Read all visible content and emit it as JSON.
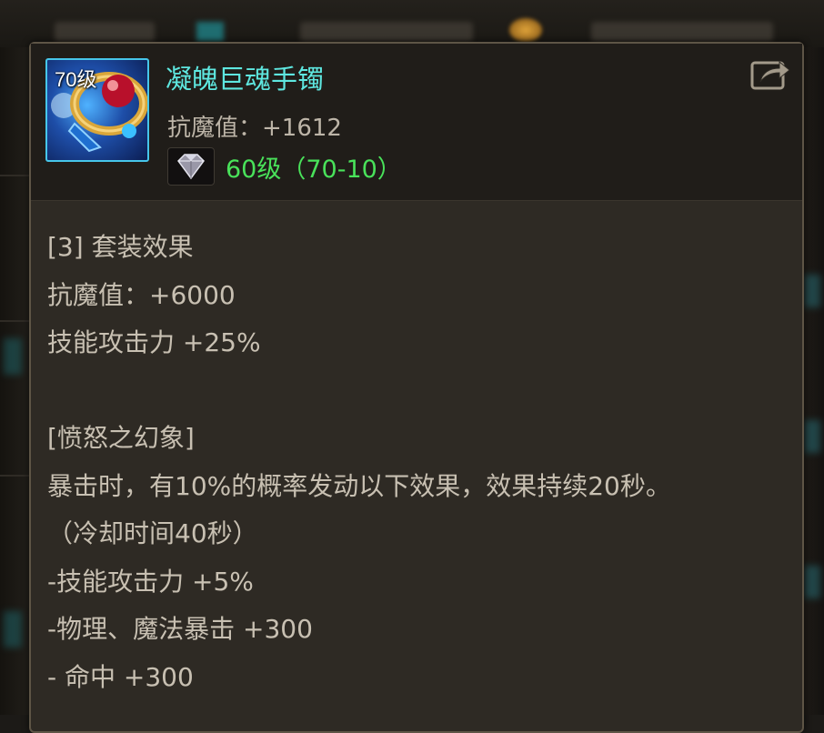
{
  "item": {
    "name": "凝魄巨魂手镯",
    "level_label": "70级",
    "stat": "抗魔值：+1612",
    "gem_level": "60级（70-10）"
  },
  "set_effect": {
    "header": "[3] 套装效果",
    "lines": [
      "抗魔值：+6000",
      "技能攻击力 +25%"
    ]
  },
  "skill": {
    "title": "[愤怒之幻象]",
    "lines": [
      "暴击时，有10%的概率发动以下效果，效果持续20秒。",
      "（冷却时间40秒）",
      "-技能攻击力 +5%",
      "-物理、魔法暴击 +300",
      "- 命中 +300"
    ]
  },
  "icons": {
    "item": "bracelet-icon",
    "gem": "diamond-gem-icon",
    "share": "share-icon"
  },
  "colors": {
    "item_name": "#5ee7e0",
    "gem_level": "#49e25a",
    "body_text": "#c8c0b2",
    "icon_border": "#46c6ea"
  }
}
